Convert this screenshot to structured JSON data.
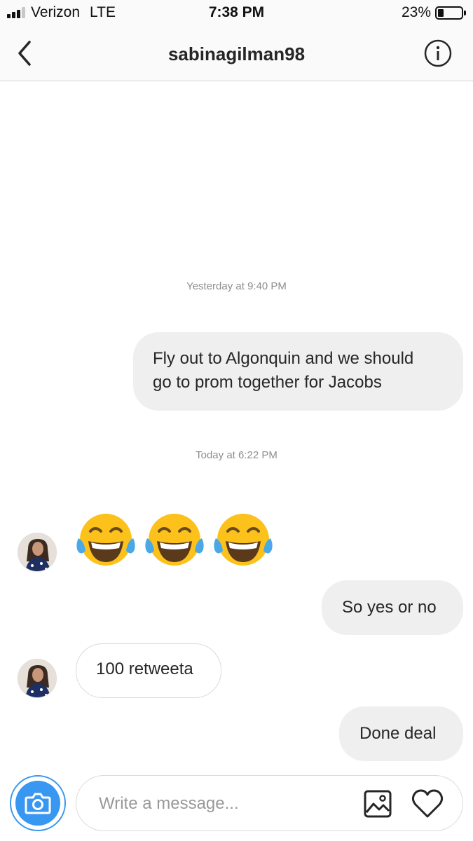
{
  "status_bar": {
    "carrier": "Verizon",
    "network": "LTE",
    "time": "7:38 PM",
    "battery_percent": "23%",
    "battery_level": 0.23,
    "signal_bars_active": 3,
    "signal_bars_total": 4
  },
  "header": {
    "username": "sabinagilman98",
    "back_icon": "chevron-left-icon",
    "info_icon": "info-circle-icon"
  },
  "conversation": {
    "timestamp_1": "Yesterday at 9:40 PM",
    "message_1": {
      "direction": "outgoing",
      "line_1": "Fly out to Algonquin and we should",
      "line_2": "go to prom together for Jacobs"
    },
    "timestamp_2": "Today at 6:22 PM",
    "message_2": {
      "direction": "incoming",
      "content": "😂😂😂",
      "emoji": "face-with-tears-of-joy",
      "count": 3
    },
    "message_3": {
      "direction": "outgoing",
      "text": "So yes or no"
    },
    "message_4": {
      "direction": "incoming",
      "text": "100 retweeta"
    },
    "message_5": {
      "direction": "outgoing",
      "text": "Done deal"
    }
  },
  "composer": {
    "placeholder": "Write a message...",
    "camera_icon": "camera-icon",
    "gallery_icon": "image-icon",
    "like_icon": "heart-icon"
  },
  "colors": {
    "accent": "#3897f0",
    "outgoing_bubble": "#efefef",
    "incoming_border": "#dbdbdb",
    "timestamp_text": "#8e8e8e",
    "emoji_yellow": "#fcc21b",
    "tear_blue": "#4aa8e8"
  }
}
